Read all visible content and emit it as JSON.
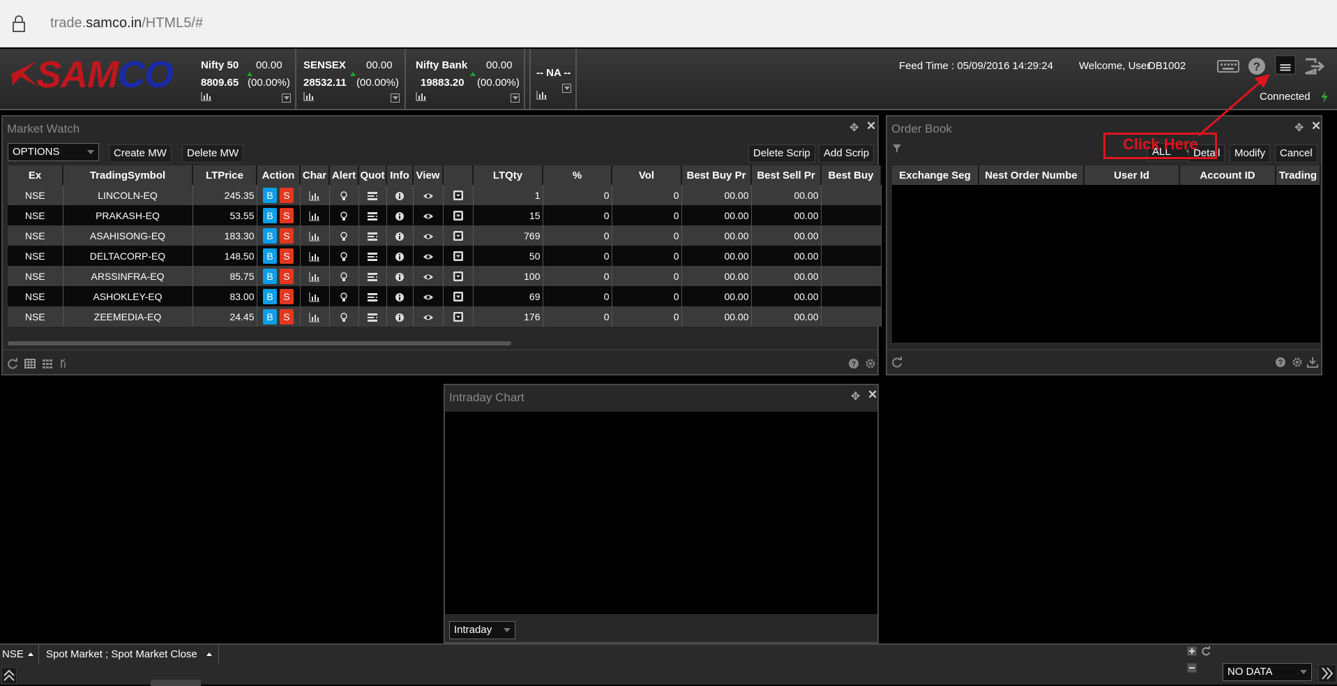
{
  "browser": {
    "url_prefix": "trade.",
    "url_domain": "samco.in",
    "url_path": "/HTML5/#"
  },
  "header": {
    "logo_text_a": "SAM",
    "logo_text_b": "CO",
    "tickers": [
      {
        "name": "Nifty 50",
        "change": "00.00",
        "value": "8809.65",
        "percent": "(00.00%)"
      },
      {
        "name": "SENSEX",
        "change": "00.00",
        "value": "28532.11",
        "percent": "(00.00%)"
      },
      {
        "name": "Nifty Bank",
        "change": "00.00",
        "value": "19883.20",
        "percent": "(00.00%)"
      },
      {
        "name": "-- NA --"
      }
    ],
    "feed_time": "Feed Time :  05/09/2016 14:29:24",
    "welcome": "Welcome, User",
    "user_id": "DB1002",
    "connection_status": "Connected"
  },
  "market_watch": {
    "title": "Market Watch",
    "dropdown_value": "OPTIONS",
    "create_label": "Create MW",
    "delete_label": "Delete MW",
    "delete_scrip_label": "Delete Scrip",
    "add_scrip_label": "Add Scrip",
    "columns": [
      "Ex",
      "TradingSymbol",
      "LTPrice",
      "Action",
      "Char",
      "Alert",
      "Quot",
      "Info",
      "View",
      "",
      "LTQty",
      "%",
      "Vol",
      "Best Buy Pr",
      "Best Sell Pr",
      "Best Buy"
    ],
    "buy_label": "B",
    "sell_label": "S",
    "rows": [
      {
        "ex": "NSE",
        "symbol": "LINCOLN-EQ",
        "ltp": "245.35",
        "ltqty": "1",
        "pct": "0",
        "vol": "0",
        "bbp": "00.00",
        "bsp": "00.00"
      },
      {
        "ex": "NSE",
        "symbol": "PRAKASH-EQ",
        "ltp": "53.55",
        "ltqty": "15",
        "pct": "0",
        "vol": "0",
        "bbp": "00.00",
        "bsp": "00.00"
      },
      {
        "ex": "NSE",
        "symbol": "ASAHISONG-EQ",
        "ltp": "183.30",
        "ltqty": "769",
        "pct": "0",
        "vol": "0",
        "bbp": "00.00",
        "bsp": "00.00"
      },
      {
        "ex": "NSE",
        "symbol": "DELTACORP-EQ",
        "ltp": "148.50",
        "ltqty": "50",
        "pct": "0",
        "vol": "0",
        "bbp": "00.00",
        "bsp": "00.00"
      },
      {
        "ex": "NSE",
        "symbol": "ARSSINFRA-EQ",
        "ltp": "85.75",
        "ltqty": "100",
        "pct": "0",
        "vol": "0",
        "bbp": "00.00",
        "bsp": "00.00"
      },
      {
        "ex": "NSE",
        "symbol": "ASHOKLEY-EQ",
        "ltp": "83.00",
        "ltqty": "69",
        "pct": "0",
        "vol": "0",
        "bbp": "00.00",
        "bsp": "00.00"
      },
      {
        "ex": "NSE",
        "symbol": "ZEEMEDIA-EQ",
        "ltp": "24.45",
        "ltqty": "176",
        "pct": "0",
        "vol": "0",
        "bbp": "00.00",
        "bsp": "00.00"
      }
    ]
  },
  "order_book": {
    "title": "Order Book",
    "filter_value": "ALL",
    "detail_label": "Detail",
    "modify_label": "Modify",
    "cancel_label": "Cancel",
    "columns": [
      "Exchange Seg",
      "Nest Order Numbe",
      "User Id",
      "Account ID",
      "Trading"
    ]
  },
  "intraday_chart": {
    "title": "Intraday Chart",
    "period_value": "Intraday"
  },
  "annotation": {
    "callout_text": "Click Here",
    "color": "#e0141e"
  },
  "status_bar": {
    "exchange": "NSE",
    "market_status": "Spot Market ; Spot Market Close",
    "data_select": "NO DATA"
  }
}
